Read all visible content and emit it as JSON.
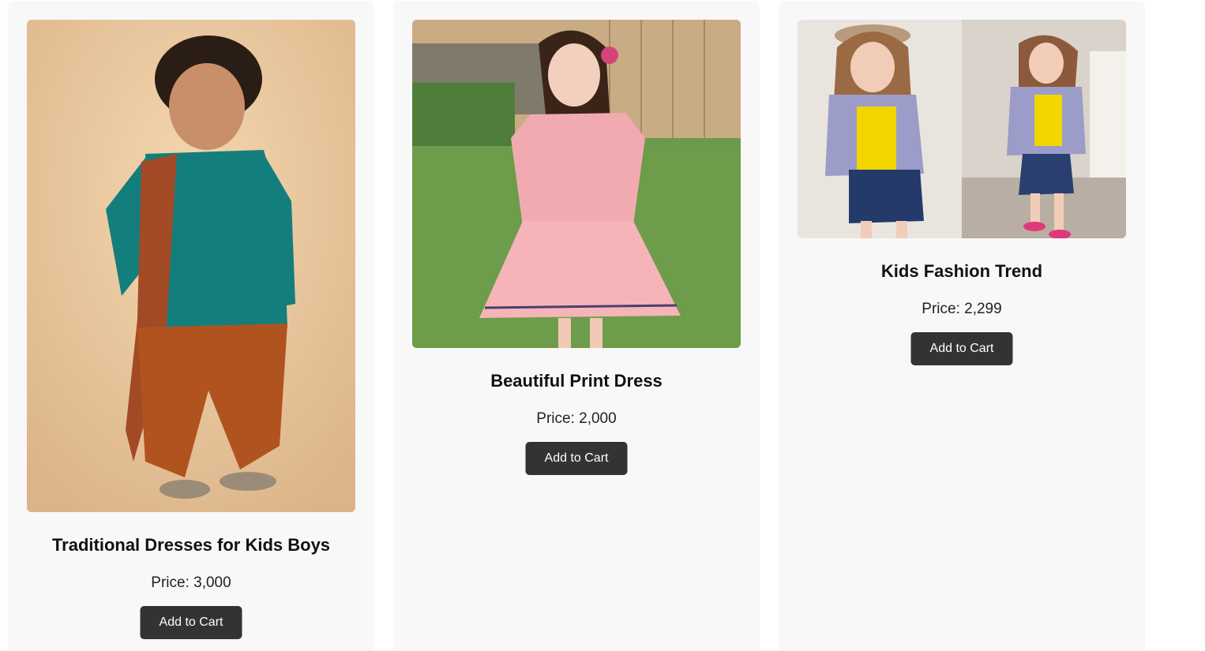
{
  "products": [
    {
      "title": "Traditional Dresses for Kids Boys",
      "price": "Price: 3,000",
      "button_label": "Add to Cart"
    },
    {
      "title": "Beautiful Print Dress",
      "price": "Price: 2,000",
      "button_label": "Add to Cart"
    },
    {
      "title": "Kids Fashion Trend",
      "price": "Price: 2,299",
      "button_label": "Add to Cart"
    }
  ],
  "colors": {
    "card_background": "#f8f8f8",
    "button_background": "#333333",
    "button_text": "#ffffff"
  }
}
